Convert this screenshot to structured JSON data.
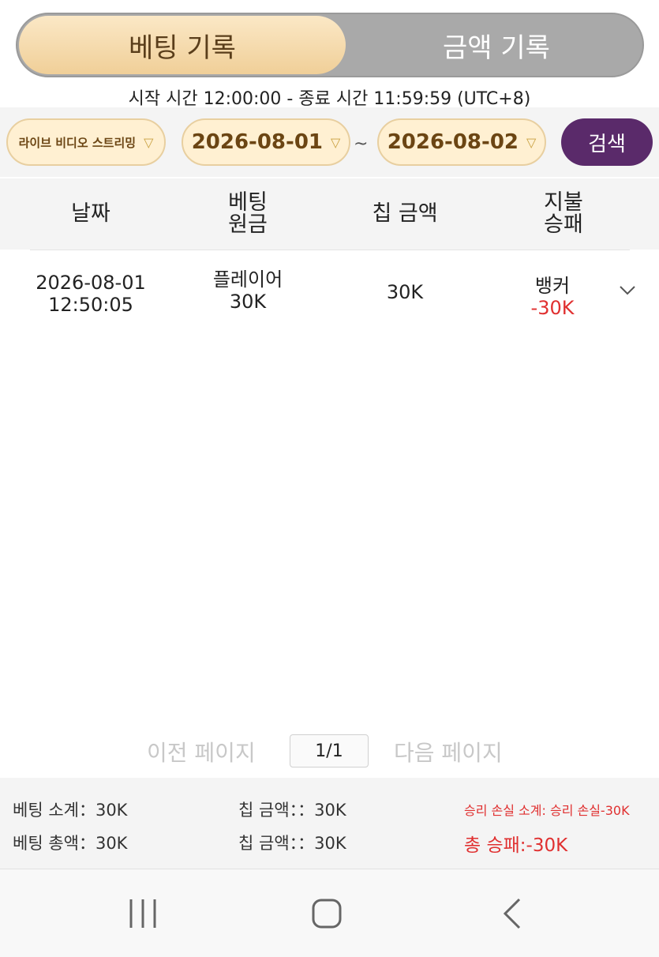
{
  "tabs": {
    "active": "베팅 기록",
    "inactive": "금액 기록"
  },
  "time_range": "시작 시간 12:00:00 - 종료 시간 11:59:59 (UTC+8)",
  "filters": {
    "stream": "라이브 비디오 스트리밍",
    "date_from": "2026-08-01",
    "separator": "~",
    "date_to": "2026-08-02",
    "search": "검색"
  },
  "table": {
    "headers": {
      "date": "날짜",
      "bet_line1": "베팅",
      "bet_line2": "원금",
      "chip": "칩 금액",
      "pay_line1": "지불",
      "pay_line2": "승패"
    },
    "rows": [
      {
        "date": "2026-08-01",
        "time": "12:50:05",
        "bet_side": "플레이어",
        "bet_amount": "30K",
        "chip": "30K",
        "result_side": "뱅커",
        "result_amount": "-30K"
      }
    ]
  },
  "pager": {
    "prev": "이전 페이지",
    "page": "1/1",
    "next": "다음 페이지"
  },
  "summary": {
    "bet_subtotal": "베팅 소계：30K",
    "chip_subtotal": "칩 금액：：30K",
    "winloss_subtotal": "승리 손실 소계: 승리 손실-30K",
    "bet_total": "베팅 총액：30K",
    "chip_total": "칩 금액：：30K",
    "winloss_total": "총 승패:-30K"
  },
  "colors": {
    "tab_active_bg": "#f0cf98",
    "search_button": "#5a2a6a",
    "loss_red": "#e03030"
  },
  "icons": {
    "nav_recent": "recent-apps-icon",
    "nav_home": "home-icon",
    "nav_back": "back-icon"
  }
}
